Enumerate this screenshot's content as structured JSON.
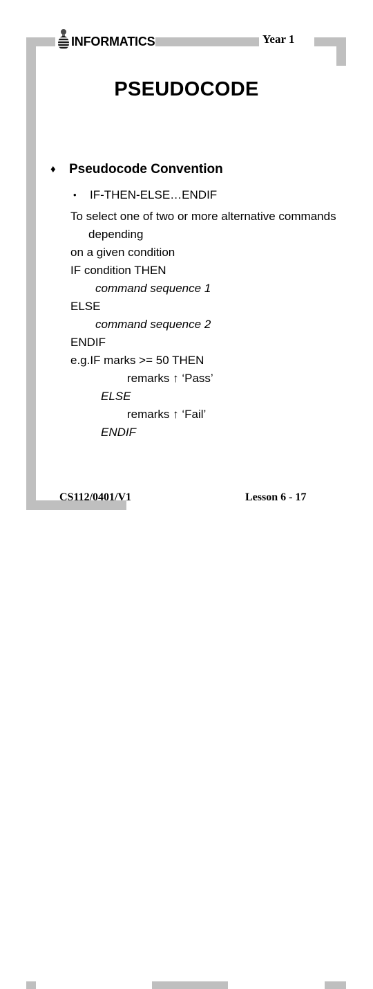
{
  "slide": {
    "title": "PSEUDOCODE",
    "header": {
      "logo_text": "INFORMATICS",
      "logo_icon": "person-figure-icon",
      "year_label": "Year 1"
    },
    "footer": {
      "code": "CS112/0401/V1",
      "lesson": "Lesson 6 - 17"
    },
    "colors": {
      "frame_gray": "#bfbfbf",
      "text": "#000000",
      "background": "#ffffff"
    }
  },
  "content": {
    "bullet_level1": {
      "marker": "♦",
      "text": "Pseudocode Convention"
    },
    "bullet_level2": {
      "marker": "•",
      "text": "IF-THEN-ELSE…ENDIF"
    },
    "code_lines": [
      {
        "text": "To select one of two or more alternative commands depending",
        "style": "wrap"
      },
      {
        "text": "on a given condition",
        "style": "plain"
      },
      {
        "text": "IF condition THEN",
        "style": "plain"
      },
      {
        "text": "command sequence 1",
        "style": "italic-indent1"
      },
      {
        "text": "ELSE",
        "style": "plain"
      },
      {
        "text": "command sequence 2",
        "style": "italic-indent1"
      },
      {
        "text": "ENDIF",
        "style": "plain"
      },
      {
        "text": "e.g.IF marks >= 50 THEN",
        "style": "plain"
      },
      {
        "text": "remarks ↑ ‘Pass’",
        "style": "indent3"
      },
      {
        "text": "ELSE",
        "style": "italic-indent2"
      },
      {
        "text": "remarks ↑ ‘Fail’",
        "style": "indent3"
      },
      {
        "text": "ENDIF",
        "style": "italic-indent2"
      }
    ]
  }
}
